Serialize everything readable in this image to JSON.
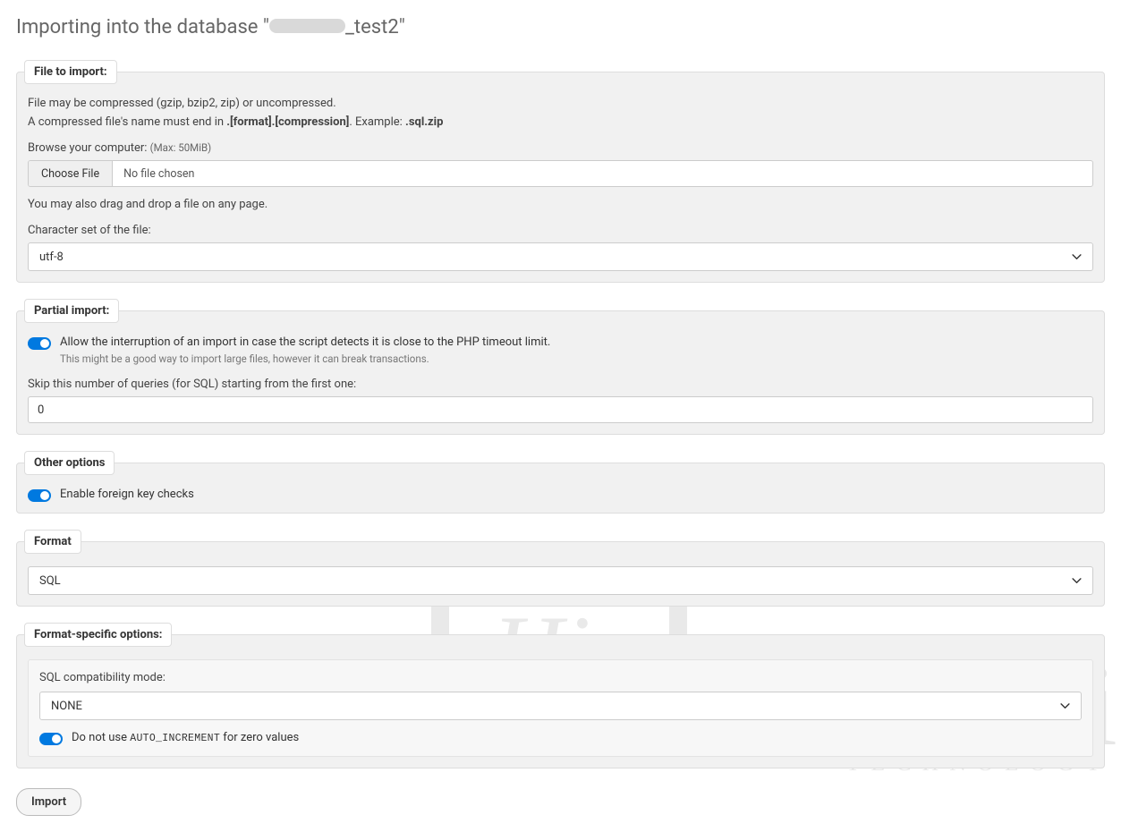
{
  "page": {
    "title_prefix": "Importing into the database \"",
    "title_suffix": "_test2\""
  },
  "file_import": {
    "legend": "File to import:",
    "compressed_hint": "File may be compressed (gzip, bzip2, zip) or uncompressed.",
    "compressed_name_prefix": "A compressed file's name must end in ",
    "compressed_name_bold": ".[format].[compression]",
    "compressed_name_mid": ". Example: ",
    "compressed_name_bold2": ".sql.zip",
    "browse_label": "Browse your computer: ",
    "browse_max": "(Max: 50MiB)",
    "choose_file_btn": "Choose File",
    "no_file_chosen": "No file chosen",
    "drag_drop_hint": "You may also drag and drop a file on any page.",
    "charset_label": "Character set of the file:",
    "charset_value": "utf-8"
  },
  "partial": {
    "legend": "Partial import:",
    "allow_interrupt_label": "Allow the interruption of an import in case the script detects it is close to the PHP timeout limit.",
    "allow_interrupt_sub": "This might be a good way to import large files, however it can break transactions.",
    "skip_label": "Skip this number of queries (for SQL) starting from the first one:",
    "skip_value": "0"
  },
  "other": {
    "legend": "Other options",
    "fk_label": "Enable foreign key checks"
  },
  "format": {
    "legend": "Format",
    "value": "SQL"
  },
  "format_specific": {
    "legend": "Format-specific options:",
    "sql_compat_label": "SQL compatibility mode:",
    "sql_compat_value": "NONE",
    "no_autoinc_prefix": "Do not use ",
    "no_autoinc_mono": "AUTO_INCREMENT",
    "no_autoinc_suffix": " for zero values"
  },
  "import_btn": "Import"
}
